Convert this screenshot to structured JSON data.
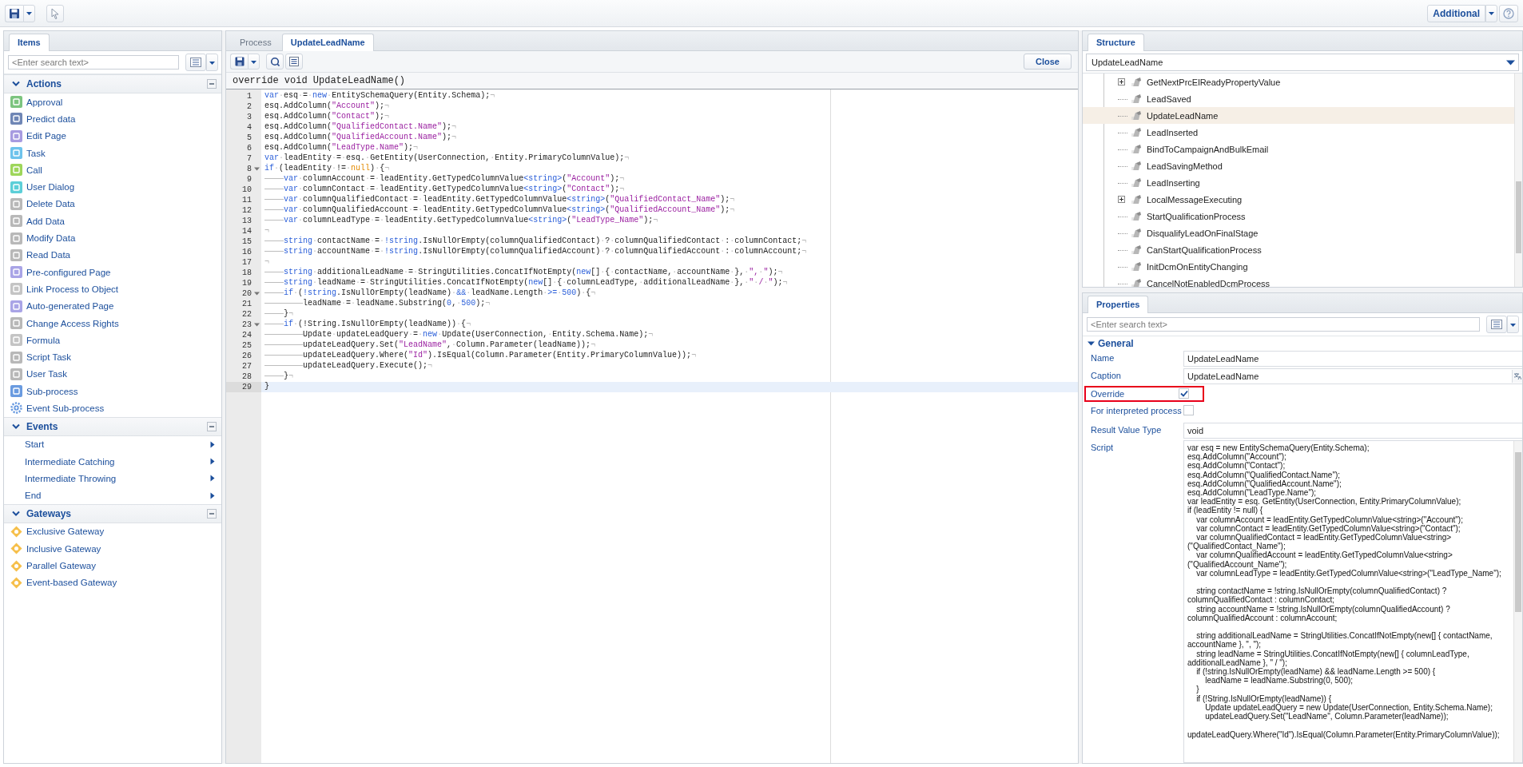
{
  "toolbar": {
    "additional_button": "Additional"
  },
  "items_panel": {
    "tab": "Items",
    "search_placeholder": "<Enter search text>",
    "groups": [
      {
        "title": "Actions",
        "expanded": true,
        "items": [
          {
            "label": "Approval",
            "kind": "tile",
            "color": "#7cc47f"
          },
          {
            "label": "Predict data",
            "kind": "tile",
            "color": "#6f86b5"
          },
          {
            "label": "Edit Page",
            "kind": "tile",
            "color": "#a79be0"
          },
          {
            "label": "Task",
            "kind": "tile",
            "color": "#6ec3ec"
          },
          {
            "label": "Call",
            "kind": "tile",
            "color": "#9ed65a"
          },
          {
            "label": "User Dialog",
            "kind": "tile",
            "color": "#5ccfd8"
          },
          {
            "label": "Delete Data",
            "kind": "tile",
            "color": "#b8b8b8"
          },
          {
            "label": "Add Data",
            "kind": "tile",
            "color": "#b8b8b8"
          },
          {
            "label": "Modify Data",
            "kind": "tile",
            "color": "#b8b8b8"
          },
          {
            "label": "Read Data",
            "kind": "tile",
            "color": "#b8b8b8"
          },
          {
            "label": "Pre-configured Page",
            "kind": "tile",
            "color": "#a9a4e6"
          },
          {
            "label": "Link Process to Object",
            "kind": "tile",
            "color": "#c4c4c4"
          },
          {
            "label": "Auto-generated Page",
            "kind": "tile",
            "color": "#a9a4e6"
          },
          {
            "label": "Change Access Rights",
            "kind": "tile",
            "color": "#b8b8b8"
          },
          {
            "label": "Formula",
            "kind": "tile",
            "color": "#c4c4c4"
          },
          {
            "label": "Script Task",
            "kind": "tile",
            "color": "#b8b8b8"
          },
          {
            "label": "User Task",
            "kind": "tile",
            "color": "#b8b8b8"
          },
          {
            "label": "Sub-process",
            "kind": "tile",
            "color": "#6a9be0"
          },
          {
            "label": "Event Sub-process",
            "kind": "gear",
            "color": "#6a9be0"
          }
        ]
      },
      {
        "title": "Events",
        "expanded": true,
        "items": [
          {
            "label": "Start",
            "kind": "submenu"
          },
          {
            "label": "Intermediate Catching",
            "kind": "submenu"
          },
          {
            "label": "Intermediate Throwing",
            "kind": "submenu"
          },
          {
            "label": "End",
            "kind": "submenu"
          }
        ]
      },
      {
        "title": "Gateways",
        "expanded": true,
        "items": [
          {
            "label": "Exclusive Gateway",
            "kind": "gateway"
          },
          {
            "label": "Inclusive Gateway",
            "kind": "gateway"
          },
          {
            "label": "Parallel Gateway",
            "kind": "gateway"
          },
          {
            "label": "Event-based Gateway",
            "kind": "gateway"
          }
        ]
      }
    ]
  },
  "editor": {
    "tabs": [
      {
        "label": "Process",
        "selected": false
      },
      {
        "label": "UpdateLeadName",
        "selected": true
      }
    ],
    "close_button": "Close",
    "signature": "override void UpdateLeadName()",
    "lines": [
      {
        "number": "1",
        "foldable": false,
        "current": false,
        "code": [
          {
            "kind": "kw",
            "text": "var"
          },
          {
            "kind": "plain",
            "text": "·esq·=·"
          },
          {
            "kind": "kw",
            "text": "new"
          },
          {
            "kind": "plain",
            "text": "·EntitySchemaQuery(Entity.Schema);¬"
          }
        ]
      },
      {
        "number": "2",
        "foldable": false,
        "current": false,
        "code": [
          {
            "kind": "plain",
            "text": "esq.AddColumn("
          },
          {
            "kind": "str",
            "text": "\"Account\""
          },
          {
            "kind": "plain",
            "text": ");¬"
          }
        ]
      },
      {
        "number": "3",
        "foldable": false,
        "current": false,
        "code": [
          {
            "kind": "plain",
            "text": "esq.AddColumn("
          },
          {
            "kind": "str",
            "text": "\"Contact\""
          },
          {
            "kind": "plain",
            "text": ");¬"
          }
        ]
      },
      {
        "number": "4",
        "foldable": false,
        "current": false,
        "code": [
          {
            "kind": "plain",
            "text": "esq.AddColumn("
          },
          {
            "kind": "str",
            "text": "\"QualifiedContact.Name\""
          },
          {
            "kind": "plain",
            "text": ");¬"
          }
        ]
      },
      {
        "number": "5",
        "foldable": false,
        "current": false,
        "code": [
          {
            "kind": "plain",
            "text": "esq.AddColumn("
          },
          {
            "kind": "str",
            "text": "\"QualifiedAccount.Name\""
          },
          {
            "kind": "plain",
            "text": ");¬"
          }
        ]
      },
      {
        "number": "6",
        "foldable": false,
        "current": false,
        "code": [
          {
            "kind": "plain",
            "text": "esq.AddColumn("
          },
          {
            "kind": "str",
            "text": "\"LeadType.Name\""
          },
          {
            "kind": "plain",
            "text": ");¬"
          }
        ]
      },
      {
        "number": "7",
        "foldable": false,
        "current": false,
        "code": [
          {
            "kind": "kw",
            "text": "var"
          },
          {
            "kind": "plain",
            "text": "·leadEntity·=·esq.·GetEntity(UserConnection,·Entity.PrimaryColumnValue);¬"
          }
        ]
      },
      {
        "number": "8",
        "foldable": true,
        "current": false,
        "code": [
          {
            "kind": "kw",
            "text": "if"
          },
          {
            "kind": "plain",
            "text": "·(leadEntity·!=·"
          },
          {
            "kind": "lit",
            "text": "null"
          },
          {
            "kind": "plain",
            "text": ")·{¬"
          }
        ]
      },
      {
        "number": "9",
        "foldable": false,
        "current": false,
        "code": [
          {
            "kind": "kw",
            "text": "\tvar"
          },
          {
            "kind": "plain",
            "text": "·columnAccount·=·leadEntity.GetTypedColumnValue"
          },
          {
            "kind": "kw",
            "text": "<string>"
          },
          {
            "kind": "plain",
            "text": "("
          },
          {
            "kind": "str",
            "text": "\"Account\""
          },
          {
            "kind": "plain",
            "text": ");¬"
          }
        ]
      },
      {
        "number": "10",
        "foldable": false,
        "current": false,
        "code": [
          {
            "kind": "kw",
            "text": "\tvar"
          },
          {
            "kind": "plain",
            "text": "·columnContact·=·leadEntity.GetTypedColumnValue"
          },
          {
            "kind": "kw",
            "text": "<string>"
          },
          {
            "kind": "plain",
            "text": "("
          },
          {
            "kind": "str",
            "text": "\"Contact\""
          },
          {
            "kind": "plain",
            "text": ");¬"
          }
        ]
      },
      {
        "number": "11",
        "foldable": false,
        "current": false,
        "code": [
          {
            "kind": "kw",
            "text": "\tvar"
          },
          {
            "kind": "plain",
            "text": "·columnQualifiedContact·=·leadEntity.GetTypedColumnValue"
          },
          {
            "kind": "kw",
            "text": "<string>"
          },
          {
            "kind": "plain",
            "text": "("
          },
          {
            "kind": "str",
            "text": "\"QualifiedContact_Name\""
          },
          {
            "kind": "plain",
            "text": ");¬"
          }
        ]
      },
      {
        "number": "12",
        "foldable": false,
        "current": false,
        "code": [
          {
            "kind": "kw",
            "text": "\tvar"
          },
          {
            "kind": "plain",
            "text": "·columnQualifiedAccount·=·leadEntity.GetTypedColumnValue"
          },
          {
            "kind": "kw",
            "text": "<string>"
          },
          {
            "kind": "plain",
            "text": "("
          },
          {
            "kind": "str",
            "text": "\"QualifiedAccount_Name\""
          },
          {
            "kind": "plain",
            "text": ");¬"
          }
        ]
      },
      {
        "number": "13",
        "foldable": false,
        "current": false,
        "code": [
          {
            "kind": "kw",
            "text": "\tvar"
          },
          {
            "kind": "plain",
            "text": "·columnLeadType·=·leadEntity.GetTypedColumnValue"
          },
          {
            "kind": "kw",
            "text": "<string>"
          },
          {
            "kind": "plain",
            "text": "("
          },
          {
            "kind": "str",
            "text": "\"LeadType_Name\""
          },
          {
            "kind": "plain",
            "text": ");¬"
          }
        ]
      },
      {
        "number": "14",
        "foldable": false,
        "current": false,
        "code": [
          {
            "kind": "plain",
            "text": "¬"
          }
        ]
      },
      {
        "number": "15",
        "foldable": false,
        "current": false,
        "code": [
          {
            "kind": "kw",
            "text": "\tstring"
          },
          {
            "kind": "plain",
            "text": "·contactName·=·"
          },
          {
            "kind": "kw",
            "text": "!string"
          },
          {
            "kind": "plain",
            "text": ".IsNullOrEmpty(columnQualifiedContact)·?·columnQualifiedContact·:·columnContact;¬"
          }
        ]
      },
      {
        "number": "16",
        "foldable": false,
        "current": false,
        "code": [
          {
            "kind": "kw",
            "text": "\tstring"
          },
          {
            "kind": "plain",
            "text": "·accountName·=·"
          },
          {
            "kind": "kw",
            "text": "!string"
          },
          {
            "kind": "plain",
            "text": ".IsNullOrEmpty(columnQualifiedAccount)·?·columnQualifiedAccount·:·columnAccount;¬"
          }
        ]
      },
      {
        "number": "17",
        "foldable": false,
        "current": false,
        "code": [
          {
            "kind": "plain",
            "text": "¬"
          }
        ]
      },
      {
        "number": "18",
        "foldable": false,
        "current": false,
        "code": [
          {
            "kind": "kw",
            "text": "\tstring"
          },
          {
            "kind": "plain",
            "text": "·additionalLeadName·=·StringUtilities.ConcatIfNotEmpty("
          },
          {
            "kind": "kw",
            "text": "new"
          },
          {
            "kind": "plain",
            "text": "[]·{·contactName,·accountName·},·"
          },
          {
            "kind": "str",
            "text": "\",·\""
          },
          {
            "kind": "plain",
            "text": ");¬"
          }
        ]
      },
      {
        "number": "19",
        "foldable": false,
        "current": false,
        "code": [
          {
            "kind": "kw",
            "text": "\tstring"
          },
          {
            "kind": "plain",
            "text": "·leadName·=·StringUtilities.ConcatIfNotEmpty("
          },
          {
            "kind": "kw",
            "text": "new"
          },
          {
            "kind": "plain",
            "text": "[]·{·columnLeadType,·additionalLeadName·},·"
          },
          {
            "kind": "str",
            "text": "\"·/·\""
          },
          {
            "kind": "plain",
            "text": ");¬"
          }
        ]
      },
      {
        "number": "20",
        "foldable": true,
        "current": false,
        "code": [
          {
            "kind": "kw",
            "text": "\tif"
          },
          {
            "kind": "plain",
            "text": "·("
          },
          {
            "kind": "kw",
            "text": "!string"
          },
          {
            "kind": "plain",
            "text": ".IsNullOrEmpty(leadName)·"
          },
          {
            "kind": "kw",
            "text": "&&"
          },
          {
            "kind": "plain",
            "text": "·leadName.Length·"
          },
          {
            "kind": "kw",
            "text": ">="
          },
          {
            "kind": "plain",
            "text": "·"
          },
          {
            "kind": "num",
            "text": "500"
          },
          {
            "kind": "plain",
            "text": ")·{¬"
          }
        ]
      },
      {
        "number": "21",
        "foldable": false,
        "current": false,
        "code": [
          {
            "kind": "plain",
            "text": "\t\tleadName·=·leadName.Substring("
          },
          {
            "kind": "num",
            "text": "0"
          },
          {
            "kind": "plain",
            "text": ",·"
          },
          {
            "kind": "num",
            "text": "500"
          },
          {
            "kind": "plain",
            "text": ");¬"
          }
        ]
      },
      {
        "number": "22",
        "foldable": false,
        "current": false,
        "code": [
          {
            "kind": "plain",
            "text": "\t}¬"
          }
        ]
      },
      {
        "number": "23",
        "foldable": true,
        "current": false,
        "code": [
          {
            "kind": "kw",
            "text": "\tif"
          },
          {
            "kind": "plain",
            "text": "·(!String.IsNullOrEmpty(leadName))·{¬"
          }
        ]
      },
      {
        "number": "24",
        "foldable": false,
        "current": false,
        "code": [
          {
            "kind": "plain",
            "text": "\t\tUpdate·updateLeadQuery·=·"
          },
          {
            "kind": "kw",
            "text": "new"
          },
          {
            "kind": "plain",
            "text": "·Update(UserConnection,·Entity.Schema.Name);¬"
          }
        ]
      },
      {
        "number": "25",
        "foldable": false,
        "current": false,
        "code": [
          {
            "kind": "plain",
            "text": "\t\tupdateLeadQuery.Set("
          },
          {
            "kind": "str",
            "text": "\"LeadName\""
          },
          {
            "kind": "plain",
            "text": ",·Column.Parameter(leadName));¬"
          }
        ]
      },
      {
        "number": "26",
        "foldable": false,
        "current": false,
        "code": [
          {
            "kind": "plain",
            "text": "\t\tupdateLeadQuery.Where("
          },
          {
            "kind": "str",
            "text": "\"Id\""
          },
          {
            "kind": "plain",
            "text": ").IsEqual(Column.Parameter(Entity.PrimaryColumnValue));¬"
          }
        ]
      },
      {
        "number": "27",
        "foldable": false,
        "current": false,
        "code": [
          {
            "kind": "plain",
            "text": "\t\tupdateLeadQuery.Execute();¬"
          }
        ]
      },
      {
        "number": "28",
        "foldable": false,
        "current": false,
        "code": [
          {
            "kind": "plain",
            "text": "\t}¬"
          }
        ]
      },
      {
        "number": "29",
        "foldable": false,
        "current": true,
        "code": [
          {
            "kind": "plain",
            "text": "}"
          }
        ]
      }
    ]
  },
  "structure": {
    "tab": "Structure",
    "selector": "UpdateLeadName",
    "nodes": [
      {
        "label": "GetNextPrcElReadyPropertyValue",
        "kind": "collapsed",
        "selected": false
      },
      {
        "label": "LeadSaved",
        "kind": "leaf",
        "selected": false
      },
      {
        "label": "UpdateLeadName",
        "kind": "leaf",
        "selected": true
      },
      {
        "label": "LeadInserted",
        "kind": "leaf",
        "selected": false
      },
      {
        "label": "BindToCampaignAndBulkEmail",
        "kind": "leaf",
        "selected": false
      },
      {
        "label": "LeadSavingMethod",
        "kind": "leaf",
        "selected": false
      },
      {
        "label": "LeadInserting",
        "kind": "leaf",
        "selected": false
      },
      {
        "label": "LocalMessageExecuting",
        "kind": "collapsed",
        "selected": false
      },
      {
        "label": "StartQualificationProcess",
        "kind": "leaf",
        "selected": false
      },
      {
        "label": "DisqualifyLeadOnFinalStage",
        "kind": "leaf",
        "selected": false
      },
      {
        "label": "CanStartQualificationProcess",
        "kind": "leaf",
        "selected": false
      },
      {
        "label": "InitDcmOnEntityChanging",
        "kind": "leaf",
        "selected": false
      },
      {
        "label": "CancelNotEnabledDcmProcess",
        "kind": "leaf",
        "selected": false
      }
    ]
  },
  "properties": {
    "tab": "Properties",
    "search_placeholder": "<Enter search text>",
    "section": {
      "title": "General",
      "expanded": true
    },
    "rows": [
      {
        "label": "Name",
        "kind": "text",
        "value": "UpdateLeadName",
        "translatable": false,
        "highlighted": false
      },
      {
        "label": "Caption",
        "kind": "text",
        "value": "UpdateLeadName",
        "translatable": true,
        "highlighted": false
      },
      {
        "label": "Override",
        "kind": "checkbox",
        "checked": true,
        "highlighted": true
      },
      {
        "label": "For interpreted process",
        "kind": "checkbox",
        "checked": false,
        "highlighted": false
      },
      {
        "label": "Result Value Type",
        "kind": "text",
        "value": "void",
        "translatable": false,
        "highlighted": false
      },
      {
        "label": "Script",
        "kind": "script",
        "value": "var esq = new EntitySchemaQuery(Entity.Schema);\nesq.AddColumn(\"Account\");\nesq.AddColumn(\"Contact\");\nesq.AddColumn(\"QualifiedContact.Name\");\nesq.AddColumn(\"QualifiedAccount.Name\");\nesq.AddColumn(\"LeadType.Name\");\nvar leadEntity = esq. GetEntity(UserConnection, Entity.PrimaryColumnValue);\nif (leadEntity != null) {\n\tvar columnAccount = leadEntity.GetTypedColumnValue<string>(\"Account\");\n\tvar columnContact = leadEntity.GetTypedColumnValue<string>(\"Contact\");\n\tvar columnQualifiedContact = leadEntity.GetTypedColumnValue<string>(\"QualifiedContact_Name\");\n\tvar columnQualifiedAccount = leadEntity.GetTypedColumnValue<string>(\"QualifiedAccount_Name\");\n\tvar columnLeadType = leadEntity.GetTypedColumnValue<string>(\"LeadType_Name\");\n\n\tstring contactName = !string.IsNullOrEmpty(columnQualifiedContact) ? columnQualifiedContact : columnContact;\n\tstring accountName = !string.IsNullOrEmpty(columnQualifiedAccount) ? columnQualifiedAccount : columnAccount;\n\n\tstring additionalLeadName = StringUtilities.ConcatIfNotEmpty(new[] { contactName, accountName }, \", \");\n\tstring leadName = StringUtilities.ConcatIfNotEmpty(new[] { columnLeadType, additionalLeadName }, \" / \");\n\tif (!string.IsNullOrEmpty(leadName) && leadName.Length >= 500) {\n\t\tleadName = leadName.Substring(0, 500);\n\t}\n\tif (!String.IsNullOrEmpty(leadName)) {\n\t\tUpdate updateLeadQuery = new Update(UserConnection, Entity.Schema.Name);\n\t\tupdateLeadQuery.Set(\"LeadName\", Column.Parameter(leadName));\n\t\tupdateLeadQuery.Where(\"Id\").IsEqual(Column.Parameter(Entity.PrimaryColumnValue));",
        "highlighted": false
      }
    ]
  }
}
